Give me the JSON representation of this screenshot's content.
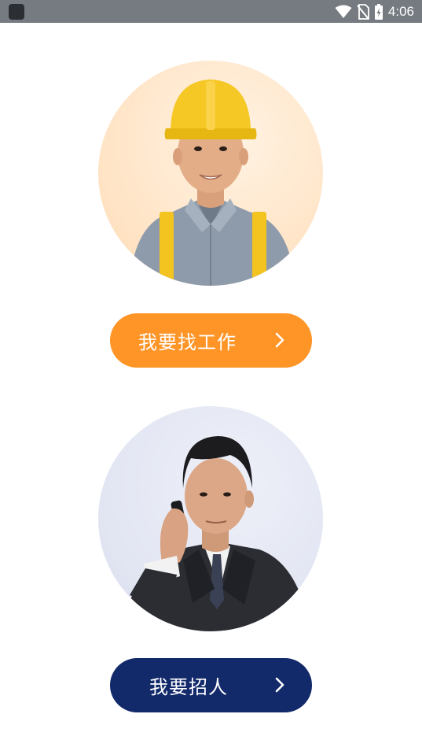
{
  "status_bar": {
    "time": "4:06",
    "icons": [
      "app-icon",
      "wifi-icon",
      "no-sim-icon",
      "battery-icon"
    ]
  },
  "job_seeker": {
    "image": "construction-worker-portrait",
    "button_label": "我要找工作",
    "button_icon": "chevron-right-icon",
    "button_color": "#ff9427"
  },
  "recruiter": {
    "image": "businessman-portrait",
    "button_label": "我要招人",
    "button_icon": "chevron-right-icon",
    "button_color": "#12296a"
  }
}
